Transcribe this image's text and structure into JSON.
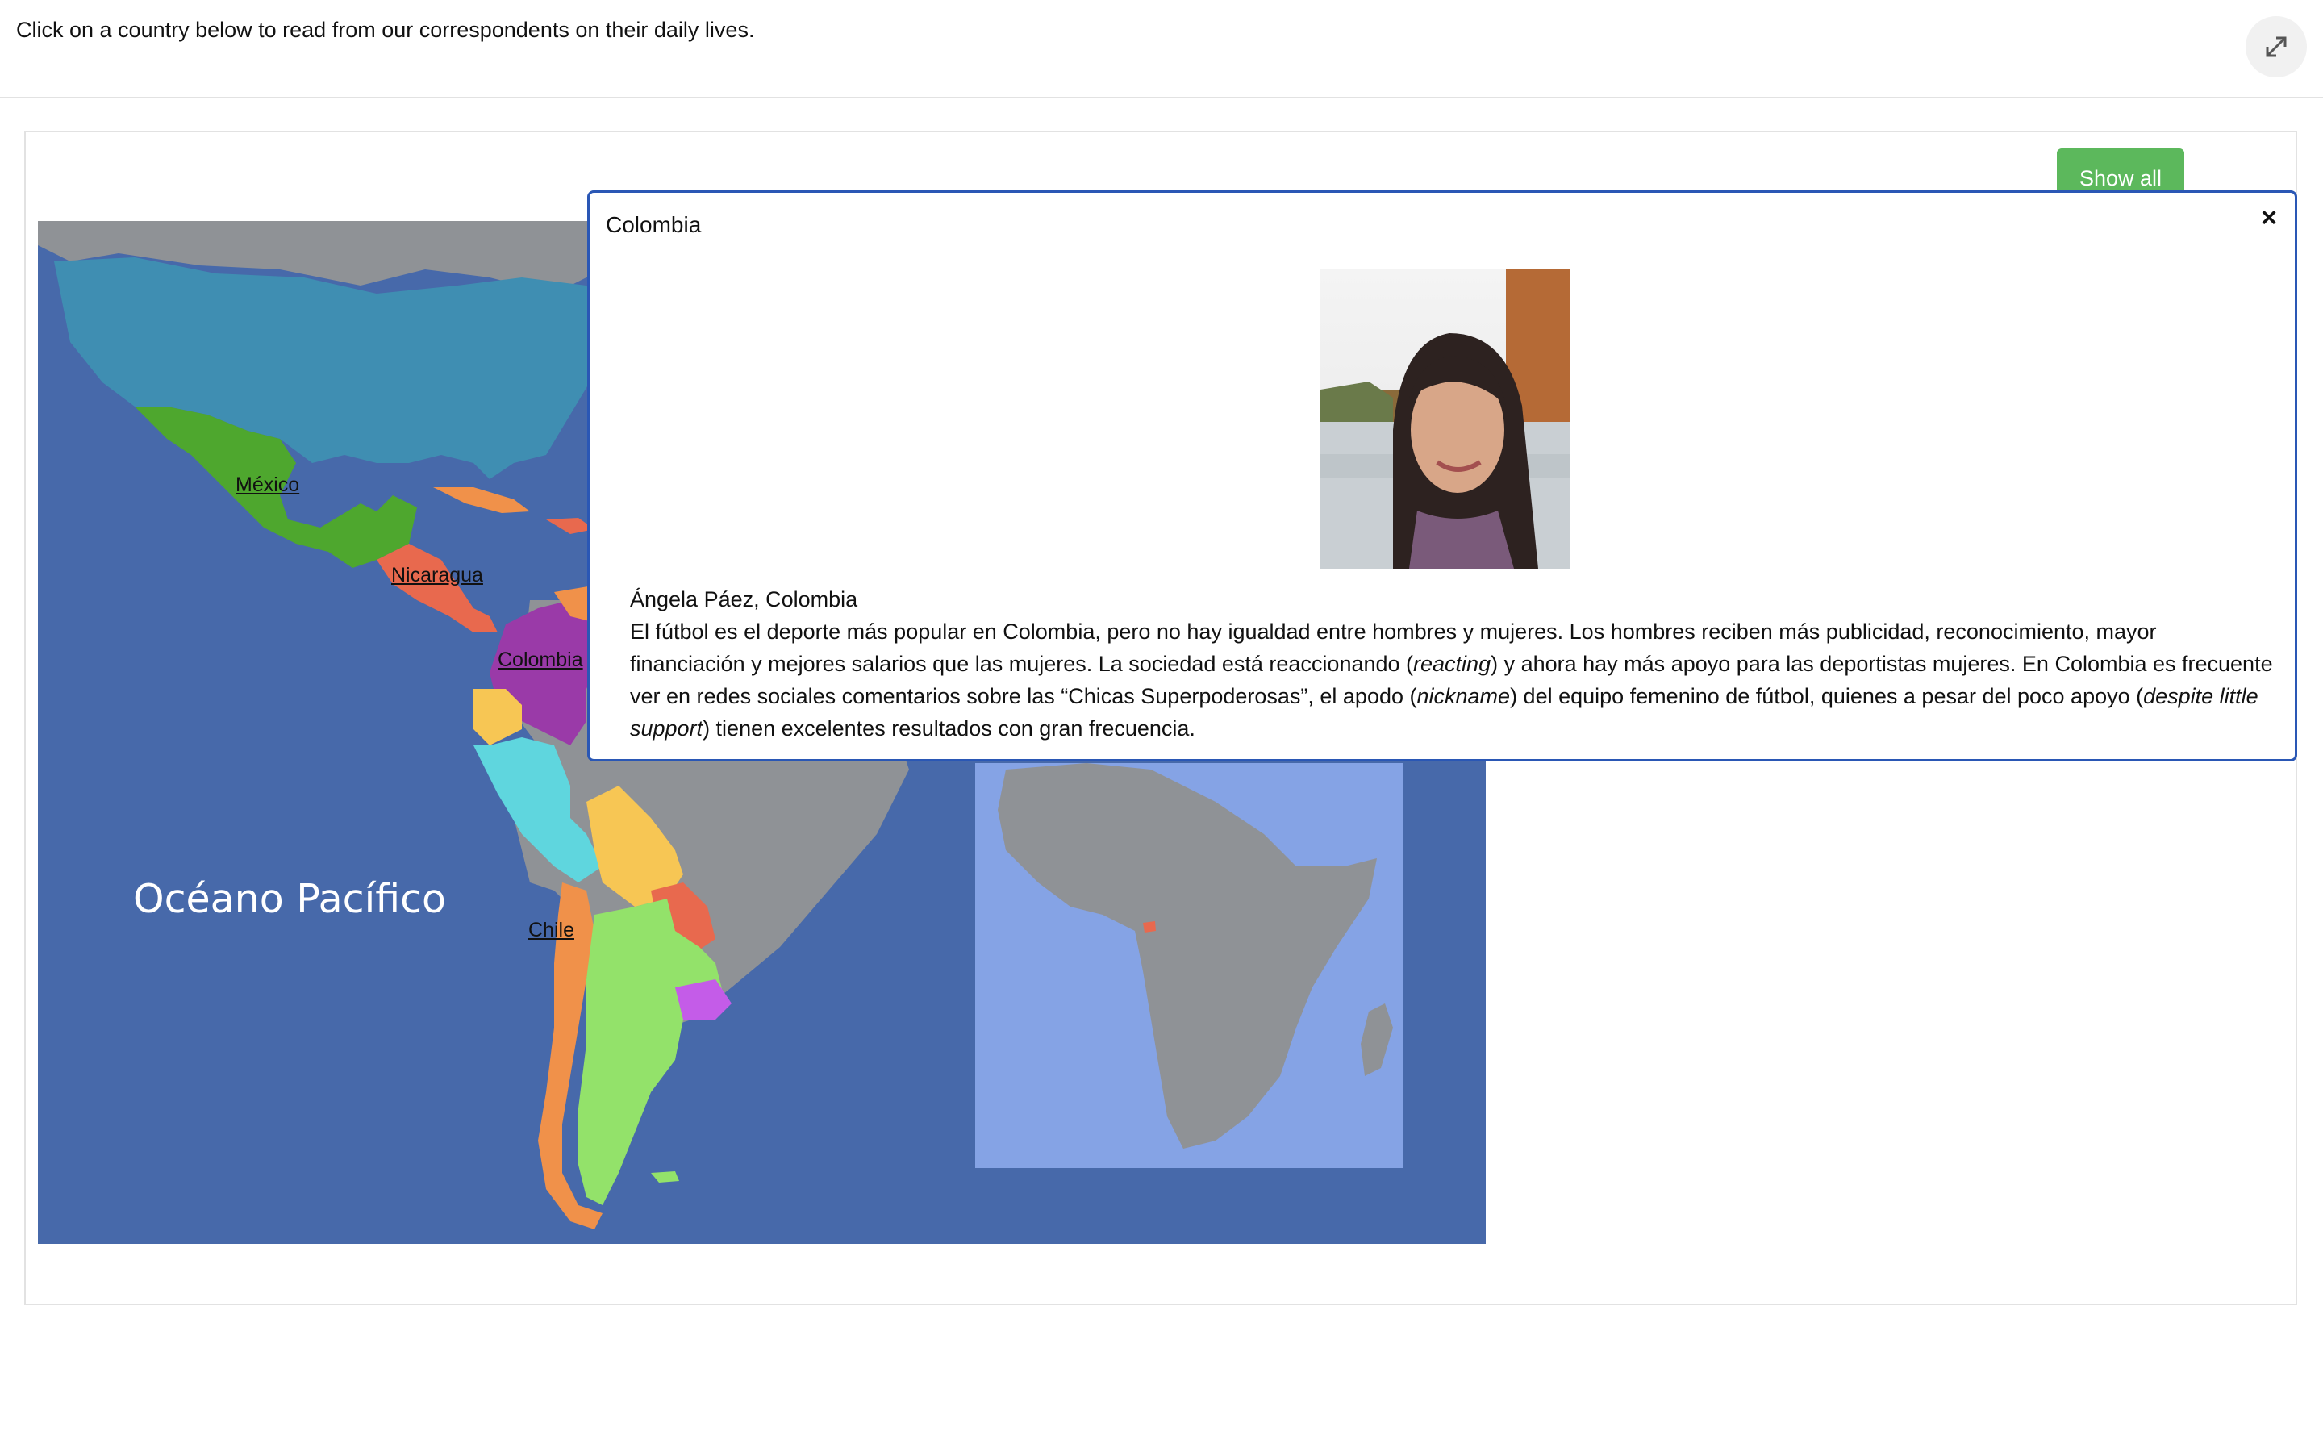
{
  "header": {
    "instructions": "Click on a country below to read from our correspondents on their daily lives."
  },
  "toolbar": {
    "show_all_label": "Show all"
  },
  "map": {
    "ocean_label": "Océano Pacífico",
    "country_links": {
      "mexico": "México",
      "nicaragua": "Nicaragua",
      "colombia": "Colombia",
      "chile": "Chile"
    },
    "colors": {
      "ocean": "#4769aa",
      "atlantic_inset": "#85a3e5",
      "land_gray": "#8f9296",
      "usa": "#3f8eb2",
      "mexico": "#4ea72e",
      "colombia": "#9a3aa8",
      "peru": "#5fd6de",
      "bolivia": "#f7c654",
      "paraguay": "#e8694e",
      "argentina": "#93e26a",
      "chile": "#f0914a",
      "uruguay": "#c45ce8"
    }
  },
  "popup": {
    "title": "Colombia",
    "close_symbol": "×",
    "author": "Ángela Páez, Colombia",
    "t1": "El fútbol es el deporte más popular en Colombia, pero no hay igualdad entre hombres y mujeres. Los hombres reciben más publicidad, reconocimiento, mayor financiación y mejores salarios que las mujeres. La sociedad está reaccionando (",
    "i1": "reacting",
    "t2": ") y ahora hay más apoyo para las deportistas mujeres. En Colombia es frecuente ver en redes sociales comentarios sobre las “Chicas Superpoderosas”, el apodo (",
    "i2": "nickname",
    "t3": ") del equipo femenino de fútbol, quienes a pesar del poco apoyo (",
    "i3": "despite little support",
    "t4": ") tienen excelentes resultados con gran frecuencia."
  }
}
